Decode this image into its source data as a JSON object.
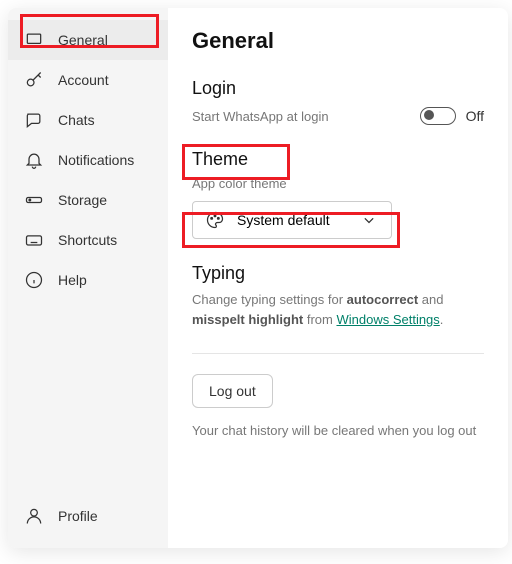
{
  "sidebar": {
    "items": [
      {
        "label": "General"
      },
      {
        "label": "Account"
      },
      {
        "label": "Chats"
      },
      {
        "label": "Notifications"
      },
      {
        "label": "Storage"
      },
      {
        "label": "Shortcuts"
      },
      {
        "label": "Help"
      }
    ],
    "profile": "Profile"
  },
  "main": {
    "title": "General",
    "login": {
      "heading": "Login",
      "sub": "Start WhatsApp at login",
      "toggle_label": "Off"
    },
    "theme": {
      "heading": "Theme",
      "sub": "App color theme",
      "selected": "System default"
    },
    "typing": {
      "heading": "Typing",
      "text_pre": "Change typing settings for ",
      "bold1": "autocorrect",
      "mid": " and ",
      "bold2": "misspelt highlight",
      "post": " from ",
      "link": "Windows Settings",
      "dot": "."
    },
    "logout": {
      "button": "Log out",
      "note": "Your chat history will be cleared when you log out"
    }
  }
}
